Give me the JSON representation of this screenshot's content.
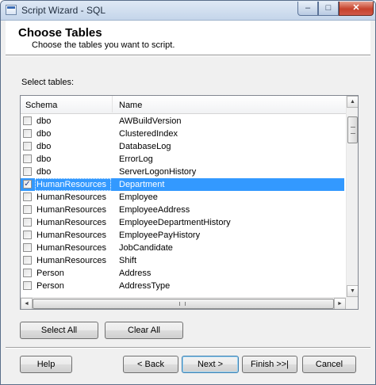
{
  "window": {
    "title": "Script Wizard - SQL",
    "controls": {
      "minimize": "–",
      "maximize": "□",
      "close": "✕"
    }
  },
  "header": {
    "title": "Choose Tables",
    "subtitle": "Choose the tables you want to script."
  },
  "select_tables_label": "Select tables:",
  "grid": {
    "columns": [
      "Schema",
      "Name"
    ],
    "rows": [
      {
        "checked": false,
        "schema": "dbo",
        "name": "AWBuildVersion",
        "selected": false
      },
      {
        "checked": false,
        "schema": "dbo",
        "name": "ClusteredIndex",
        "selected": false
      },
      {
        "checked": false,
        "schema": "dbo",
        "name": "DatabaseLog",
        "selected": false
      },
      {
        "checked": false,
        "schema": "dbo",
        "name": "ErrorLog",
        "selected": false
      },
      {
        "checked": false,
        "schema": "dbo",
        "name": "ServerLogonHistory",
        "selected": false
      },
      {
        "checked": true,
        "schema": "HumanResources",
        "name": "Department",
        "selected": true
      },
      {
        "checked": false,
        "schema": "HumanResources",
        "name": "Employee",
        "selected": false
      },
      {
        "checked": false,
        "schema": "HumanResources",
        "name": "EmployeeAddress",
        "selected": false
      },
      {
        "checked": false,
        "schema": "HumanResources",
        "name": "EmployeeDepartmentHistory",
        "selected": false
      },
      {
        "checked": false,
        "schema": "HumanResources",
        "name": "EmployeePayHistory",
        "selected": false
      },
      {
        "checked": false,
        "schema": "HumanResources",
        "name": "JobCandidate",
        "selected": false
      },
      {
        "checked": false,
        "schema": "HumanResources",
        "name": "Shift",
        "selected": false
      },
      {
        "checked": false,
        "schema": "Person",
        "name": "Address",
        "selected": false
      },
      {
        "checked": false,
        "schema": "Person",
        "name": "AddressType",
        "selected": false
      }
    ],
    "check_glyph": "✓"
  },
  "list_buttons": {
    "select_all": "Select All",
    "clear_all": "Clear All"
  },
  "footer_buttons": {
    "help": "Help",
    "back": "< Back",
    "next": "Next >",
    "finish": "Finish >>|",
    "cancel": "Cancel"
  },
  "icons": {
    "scroll_up": "▲",
    "scroll_down": "▼",
    "scroll_left": "◄",
    "scroll_right": "►"
  },
  "colors": {
    "selection": "#3399ff",
    "title_bar": "#c4d5ea",
    "close_button": "#c6422c"
  }
}
